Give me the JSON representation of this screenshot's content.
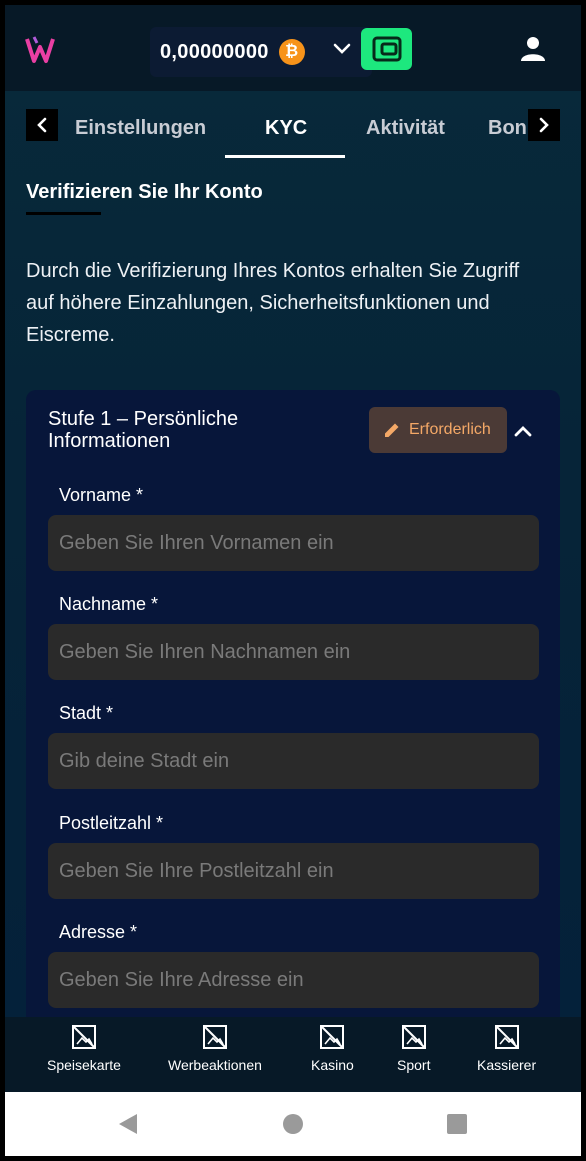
{
  "header": {
    "balance": "0,00000000",
    "currency_symbol": "₿",
    "currency_color": "#f7931a",
    "wallet_color": "#1de87e"
  },
  "tabs": [
    {
      "label": "Einstellungen",
      "active": false
    },
    {
      "label": "KYC",
      "active": true
    },
    {
      "label": "Aktivität",
      "active": false
    },
    {
      "label": "Bonu",
      "active": false
    }
  ],
  "page": {
    "section_title": "Verifizieren Sie Ihr Konto",
    "intro": "Durch die Verifizierung Ihres Kontos erhalten Sie Zugriff auf höhere Einzahlungen, Sicherheitsfunktionen und Eiscreme."
  },
  "card": {
    "title": "Stufe 1 – Persönliche Informationen",
    "badge": "Erforderlich",
    "fields": [
      {
        "label": "Vorname *",
        "placeholder": "Geben Sie Ihren Vornamen ein"
      },
      {
        "label": "Nachname *",
        "placeholder": "Geben Sie Ihren Nachnamen ein"
      },
      {
        "label": "Stadt *",
        "placeholder": "Gib deine Stadt ein"
      },
      {
        "label": "Postleitzahl *",
        "placeholder": "Geben Sie Ihre Postleitzahl ein"
      },
      {
        "label": "Adresse *",
        "placeholder": "Geben Sie Ihre Adresse ein"
      }
    ]
  },
  "bottom_nav": [
    {
      "label": "Speisekarte",
      "icon": "broken-image-icon"
    },
    {
      "label": "Werbeaktionen",
      "icon": "broken-image-icon"
    },
    {
      "label": "Kasino",
      "icon": "broken-image-icon"
    },
    {
      "label": "Sport",
      "icon": "broken-image-icon"
    },
    {
      "label": "Kassierer",
      "icon": "broken-image-icon"
    }
  ]
}
